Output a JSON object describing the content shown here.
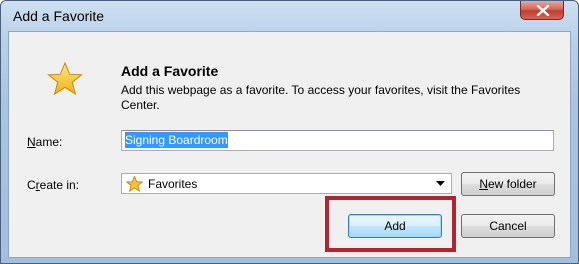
{
  "window": {
    "title": "Add a Favorite"
  },
  "dialog": {
    "heading": "Add a Favorite",
    "description": "Add this webpage as a favorite. To access your favorites, visit the Favorites Center."
  },
  "form": {
    "name_label_accel": "N",
    "name_label_rest": "ame:",
    "name_value": "Signing Boardroom",
    "create_in_label_pre": "C",
    "create_in_label_accel": "r",
    "create_in_label_rest": "eate in:",
    "create_in_selected": "Favorites"
  },
  "buttons": {
    "new_folder_accel": "N",
    "new_folder_rest": "ew folder",
    "add": "Add",
    "cancel": "Cancel"
  },
  "icons": {
    "dialog_icon": "favorite-star-icon",
    "folder_icon": "favorites-star-icon",
    "close_icon": "close-x-icon",
    "dropdown_icon": "chevron-down-icon"
  },
  "colors": {
    "highlight": "#b52230",
    "selection": "#3399ff",
    "close_button": "#c13b2e"
  }
}
